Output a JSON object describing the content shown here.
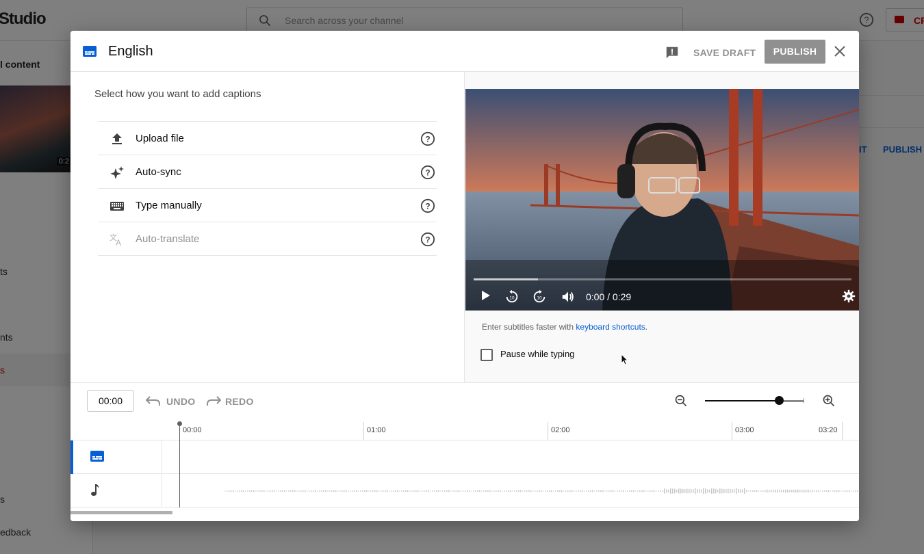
{
  "background": {
    "logo": "Studio",
    "search_placeholder": "Search across your channel",
    "create_label": "CR",
    "sidebar_title": "l content",
    "thumb_time": "0:2",
    "sidebar_items": [
      {
        "label": "ts"
      },
      {
        "label": "nts"
      },
      {
        "label": "s"
      },
      {
        "label": "s"
      },
      {
        "label": "edback"
      }
    ],
    "right_buttons": [
      "IT",
      "PUBLISH"
    ]
  },
  "dialog": {
    "title": "English",
    "save_draft": "SAVE DRAFT",
    "publish": "PUBLISH",
    "select_label": "Select how you want to add captions",
    "options": [
      {
        "label": "Upload file",
        "icon": "upload-icon",
        "disabled": false
      },
      {
        "label": "Auto-sync",
        "icon": "sparkle-icon",
        "disabled": false
      },
      {
        "label": "Type manually",
        "icon": "keyboard-icon",
        "disabled": false
      },
      {
        "label": "Auto-translate",
        "icon": "translate-icon",
        "disabled": true
      }
    ]
  },
  "player": {
    "time": "0:00 / 0:29",
    "progress_buffered": 0.17,
    "hint_prefix": "Enter subtitles faster with ",
    "hint_link": "keyboard shortcuts",
    "hint_suffix": ".",
    "pause_label": "Pause while typing",
    "pause_checked": false
  },
  "timeline": {
    "current_time": "00:00",
    "undo": "UNDO",
    "redo": "REDO",
    "zoom_level": 0.75,
    "ruler": [
      "00:00",
      "01:00",
      "02:00",
      "03:00",
      "03:20"
    ]
  },
  "colors": {
    "accent": "#065fd4",
    "disabled": "#909090",
    "brand_red": "#cc0000"
  }
}
